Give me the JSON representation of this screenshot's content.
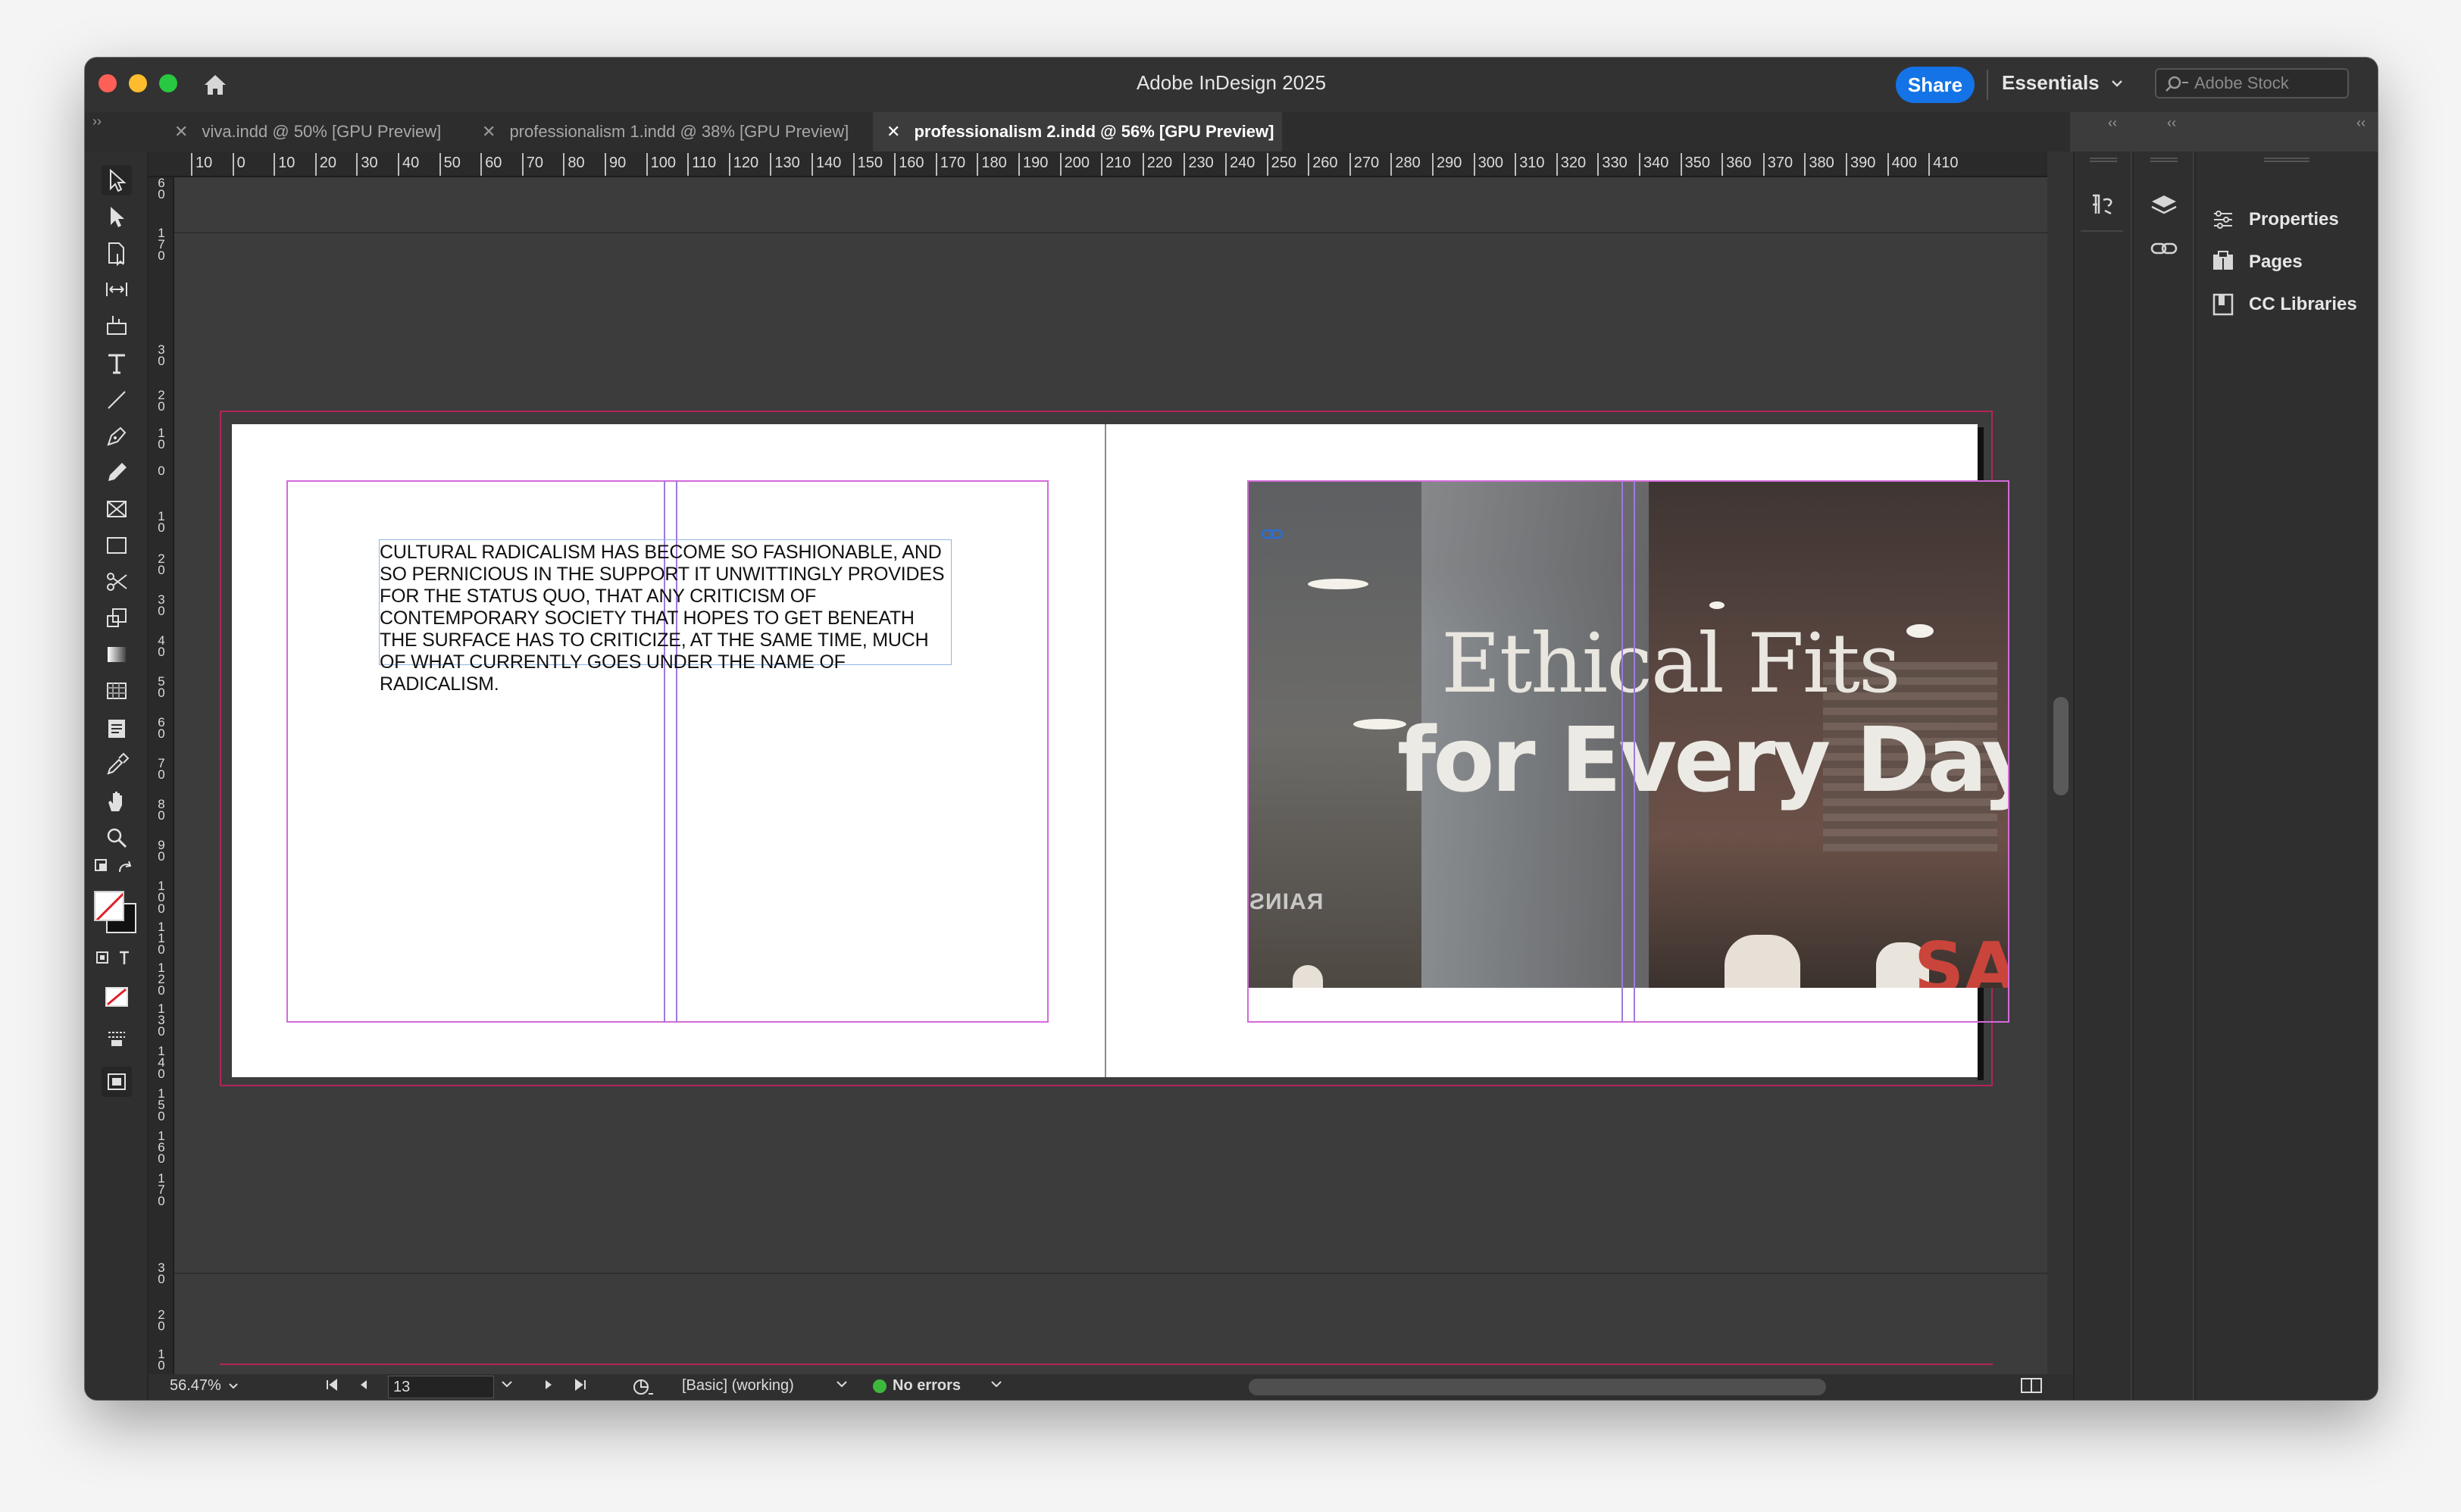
{
  "app": {
    "title": "Adobe InDesign 2025",
    "share_label": "Share",
    "workspace_label": "Essentials",
    "stock_placeholder": "Adobe Stock"
  },
  "tabs": [
    {
      "label": "viva.indd @ 50% [GPU Preview]",
      "active": false
    },
    {
      "label": "professionalism 1.indd @ 38% [GPU Preview]",
      "active": false
    },
    {
      "label": "professionalism 2.indd @ 56% [GPU Preview]",
      "active": true
    }
  ],
  "ruler": {
    "h_ticks": [
      "10",
      "0",
      "10",
      "20",
      "30",
      "40",
      "50",
      "60",
      "70",
      "80",
      "90",
      "100",
      "110",
      "120",
      "130",
      "140",
      "150",
      "160",
      "170",
      "180",
      "190",
      "200",
      "210",
      "220",
      "230",
      "240",
      "250",
      "260",
      "270",
      "280",
      "290",
      "300",
      "310",
      "320",
      "330",
      "340",
      "350",
      "360",
      "370",
      "380",
      "390",
      "400",
      "410"
    ],
    "v_ticks": [
      "60",
      "170",
      "30",
      "20",
      "10",
      "0",
      "10",
      "20",
      "30",
      "40",
      "50",
      "60",
      "70",
      "80",
      "90",
      "100",
      "110",
      "120",
      "130",
      "140",
      "150",
      "160",
      "170",
      "30",
      "20",
      "10"
    ]
  },
  "document": {
    "body_text": "CULTURAL RADICALISM HAS BECOME SO FASHIONABLE, AND SO PERNICIOUS IN THE SUPPORT IT UNWITTINGLY PROVIDES FOR THE STATUS QUO, THAT ANY CRITICISM OF CONTEMPORARY SOCIETY THAT HOPES TO GET BENEATH THE SURFACE HAS TO CRITICIZE, AT THE SAME TIME, MUCH OF WHAT CURRENTLY GOES UNDER THE NAME OF RADICALISM.",
    "image": {
      "headline_line1": "Ethical Fits",
      "headline_line2": "for Every Day",
      "sign_text": "SA",
      "store_sign": "RAINS"
    }
  },
  "status": {
    "zoom": "56.47%",
    "page": "13",
    "preflight_profile": "[Basic] (working)",
    "errors": "No errors"
  },
  "panels": [
    {
      "label": "Properties",
      "icon": "properties-icon"
    },
    {
      "label": "Pages",
      "icon": "pages-icon"
    },
    {
      "label": "CC Libraries",
      "icon": "cc-libraries-icon"
    }
  ],
  "colors": {
    "accent": "#1473e6",
    "margin_guide": "#d46adb",
    "bleed_guide": "#b0255a",
    "ok_status": "#3db83d"
  }
}
